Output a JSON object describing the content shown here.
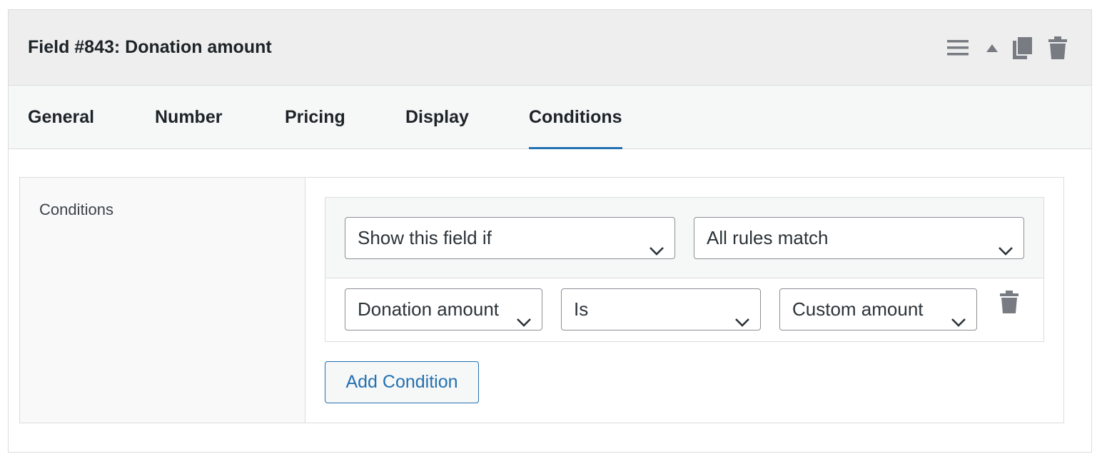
{
  "header": {
    "title": "Field #843: Donation amount",
    "icons": [
      "menu-icon",
      "arrow-up-icon",
      "duplicate-icon",
      "trash-icon"
    ]
  },
  "tabs": [
    {
      "label": "General",
      "active": false
    },
    {
      "label": "Number",
      "active": false
    },
    {
      "label": "Pricing",
      "active": false
    },
    {
      "label": "Display",
      "active": false
    },
    {
      "label": "Conditions",
      "active": true
    }
  ],
  "conditions": {
    "label": "Conditions",
    "visibility_select": "Show this field if",
    "match_select": "All rules match",
    "rule": {
      "field": "Donation amount",
      "operator": "Is",
      "value": "Custom amount"
    },
    "add_button": "Add Condition"
  },
  "colors": {
    "accent": "#2271b1",
    "header_bg": "#eeeeee",
    "icon": "#787c82"
  }
}
